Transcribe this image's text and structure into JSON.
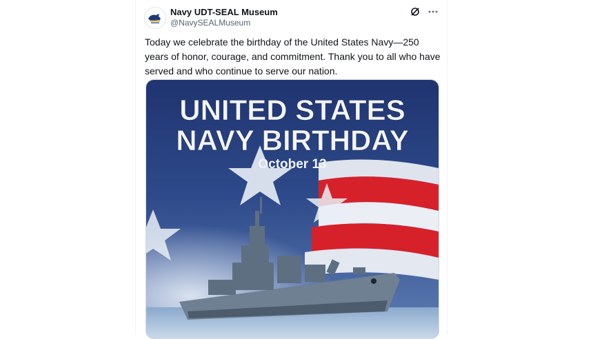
{
  "post": {
    "author_name": "Navy UDT-SEAL Museum",
    "author_handle": "@NavySEALMuseum",
    "text": "Today we celebrate the birthday of the United States Navy—250 years of honor, courage, and commitment. Thank you to all who have served and who continue to serve our nation.",
    "avatar_icon": "museum-logo-icon"
  },
  "actions": {
    "grok_icon": "grok-icon",
    "more_icon": "more-horizontal-icon"
  },
  "image": {
    "headline_line1": "UNITED STATES",
    "headline_line2": "NAVY BIRTHDAY",
    "date": "October 13"
  },
  "colors": {
    "flag_red": "#d6212b",
    "flag_blue": "#2a3f77",
    "text_dark": "#0f1419",
    "text_muted": "#536471"
  }
}
